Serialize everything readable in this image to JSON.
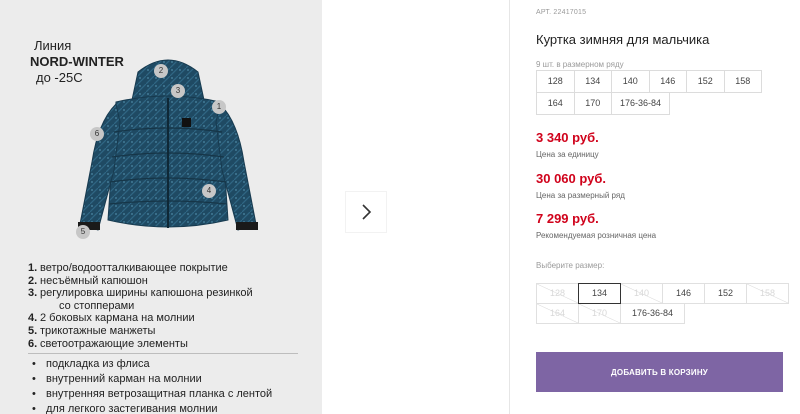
{
  "gallery": {
    "line_title": [
      "Линия",
      "NORD-WINTER",
      "до -25С"
    ],
    "markers": [
      "1",
      "2",
      "3",
      "4",
      "5",
      "6"
    ],
    "features": [
      {
        "num": "1.",
        "text": "ветро/водоотталкивающее покрытие"
      },
      {
        "num": "2.",
        "text": "несъёмный капюшон"
      },
      {
        "num": "3.",
        "text": "регулировка ширины капюшона  резинкой"
      },
      {
        "num": "",
        "text": "со стопперами"
      },
      {
        "num": "4.",
        "text": "2 боковых кармана на молнии"
      },
      {
        "num": "5.",
        "text": "трикотажные манжеты"
      },
      {
        "num": "6.",
        "text": "светоотражающие элементы"
      }
    ],
    "extras": [
      "подкладка из флиса",
      "внутренний карман на молнии",
      "внутренняя ветрозащитная планка с лентой",
      "для легкого застегивания молнии"
    ],
    "next_icon": "chevron-right-icon"
  },
  "product": {
    "article": "АРТ. 22417015",
    "title": "Куртка зимняя для мальчика",
    "range_caption": "9 шт. в размерном ряду",
    "range_sizes": [
      [
        "128",
        "134",
        "140",
        "146",
        "152",
        "158"
      ],
      [
        "164",
        "170",
        "176-36-84"
      ]
    ],
    "prices": [
      {
        "value": "3 340 руб.",
        "note": "Цена за единицу"
      },
      {
        "value": "30 060 руб.",
        "note": "Цена за размерный ряд"
      },
      {
        "value": "7 299 руб.",
        "note": "Рекомендуемая розничная цена"
      }
    ],
    "choose_label": "Выберите размер:",
    "choose_sizes": [
      [
        {
          "label": "128",
          "state": "disabled"
        },
        {
          "label": "134",
          "state": "selected"
        },
        {
          "label": "140",
          "state": "disabled"
        },
        {
          "label": "146",
          "state": "available"
        },
        {
          "label": "152",
          "state": "available"
        },
        {
          "label": "158",
          "state": "disabled"
        }
      ],
      [
        {
          "label": "164",
          "state": "disabled"
        },
        {
          "label": "170",
          "state": "disabled"
        },
        {
          "label": "176-36-84",
          "state": "available"
        }
      ]
    ],
    "cart_button": "ДОБАВИТЬ В КОРЗИНУ"
  },
  "colors": {
    "price": "#d0021b",
    "cart_button": "#7e65a4",
    "jacket": "#1f4a63",
    "image_background": "#ececec"
  }
}
